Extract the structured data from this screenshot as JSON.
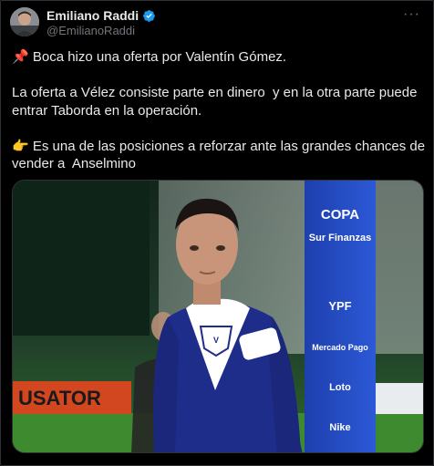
{
  "author": {
    "name": "Emiliano Raddi",
    "handle": "@EmilianoRaddi",
    "avatar_icon": "profile-photo",
    "verified_icon": "verified-badge-icon",
    "verified_color": "#1d9bf0"
  },
  "more_label": "···",
  "tweet": {
    "line1_emoji": "📌",
    "line1_text": " Boca hizo una oferta por Valentín Gómez.",
    "paragraph2": "La oferta a Vélez consiste parte en dinero  y en la otra parte puede entrar Taborda en la operación.",
    "line3_emoji": "👉",
    "line3_text": " Es una de las posiciones a reforzar ante las grandes chances de vender a  Anselmino"
  },
  "media": {
    "image_icon": "football-player-photo",
    "ad_board": "USATOR",
    "banner": {
      "copa": "COPA",
      "sponsor": "Sur Finanzas",
      "brand1": "YPF",
      "brand2": "Mercado Pago",
      "brand3": "Loto",
      "brand4": "Nike"
    }
  }
}
